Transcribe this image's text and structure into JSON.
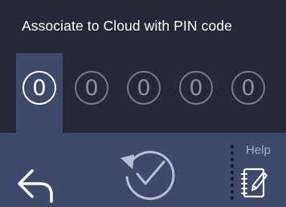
{
  "title": "Associate to Cloud with PIN code",
  "pin": {
    "digits": [
      "0",
      "0",
      "0",
      "0",
      "0"
    ],
    "active_index": 0
  },
  "footer": {
    "help_label": "Help"
  },
  "icons": {
    "back": "back-arrow-icon",
    "confirm": "confirm-check-icon",
    "help": "help-notepad-icon"
  },
  "colors": {
    "background": "#3d4a6b",
    "panel": "#262738",
    "active_digit": "#ffffff",
    "inactive_digit": "#8d91a2"
  }
}
